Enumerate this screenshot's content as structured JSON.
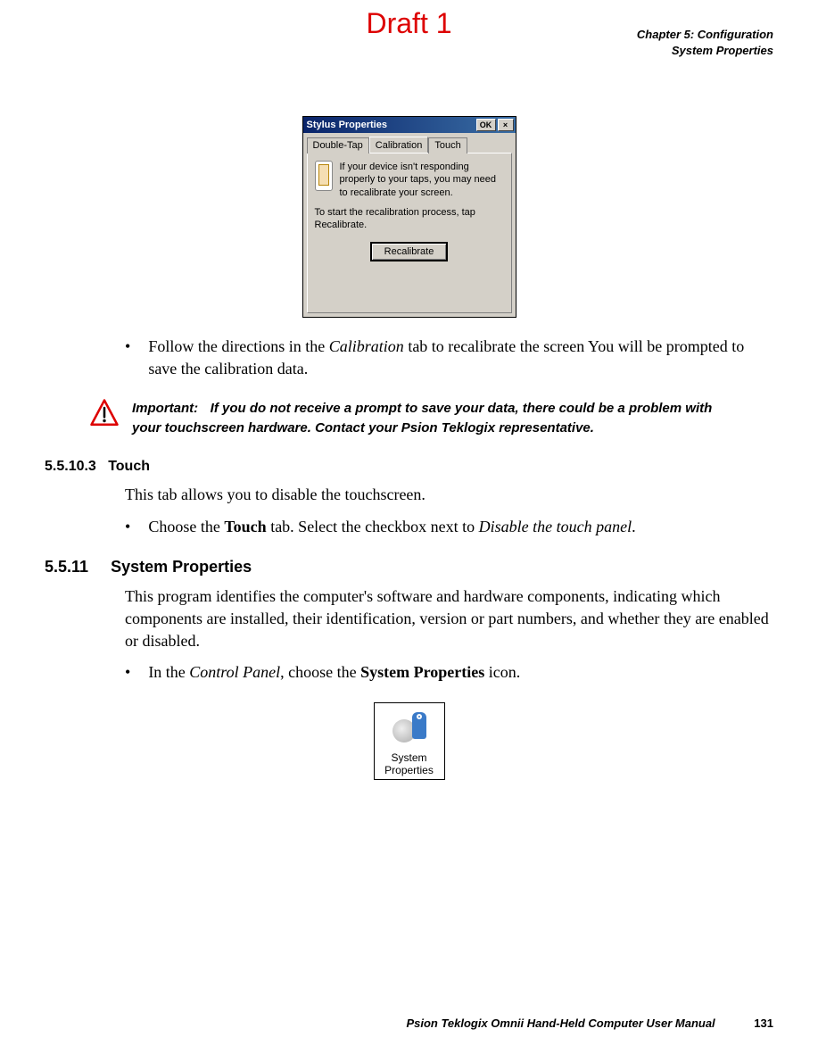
{
  "draft": "Draft 1",
  "header": {
    "line1": "Chapter 5:  Configuration",
    "line2": "System Properties"
  },
  "dialog": {
    "title": "Stylus Properties",
    "ok_label": "OK",
    "close_label": "×",
    "tabs": [
      "Double-Tap",
      "Calibration",
      "Touch"
    ],
    "info_text": "If your device isn't responding properly to your taps, you may need to recalibrate your screen.",
    "hint_text": "To start the recalibration process, tap Recalibrate.",
    "recalibrate_label": "Recalibrate"
  },
  "bullet1_pre": "Follow the directions in the ",
  "bullet1_em": "Calibration",
  "bullet1_post": " tab to recalibrate the screen You will be prompted to save the calibration data.",
  "important": {
    "label": "Important:",
    "text": "If you do not receive a prompt to save your data, there could be a problem with your touchscreen hardware. Contact your Psion Teklogix representative."
  },
  "sec_touch": {
    "num": "5.5.10.3",
    "title": "Touch",
    "para": "This tab allows you to disable the touchscreen.",
    "bullet_pre": "Choose the ",
    "bullet_bold": "Touch",
    "bullet_mid": " tab. Select the checkbox next to ",
    "bullet_em": "Disable the touch panel",
    "bullet_post": "."
  },
  "sec_sys": {
    "num": "5.5.11",
    "title": "System Properties",
    "para": "This program identifies the computer's software and hardware components, indicating which components are installed, their identification, version or part numbers, and whether they are enabled or disabled.",
    "bullet_pre": "In the ",
    "bullet_em": "Control Panel",
    "bullet_mid": ", choose the ",
    "bullet_bold": "System Properties",
    "bullet_post": " icon."
  },
  "icon_label_l1": "System",
  "icon_label_l2": "Properties",
  "footer": {
    "text": "Psion Teklogix Omnii Hand-Held Computer User Manual",
    "page": "131"
  }
}
